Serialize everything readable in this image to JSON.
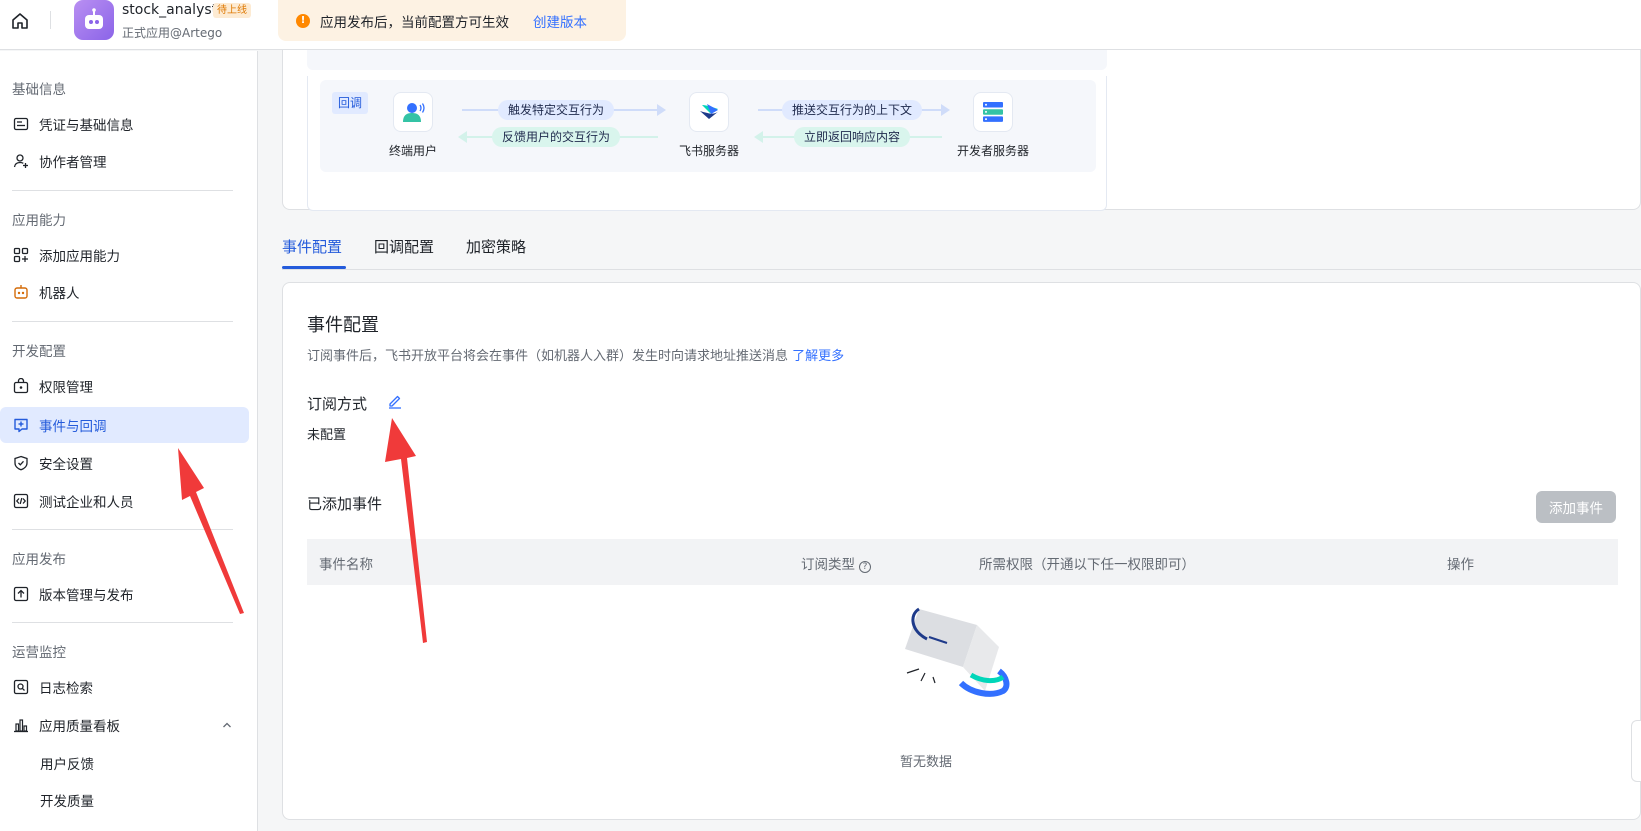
{
  "topbar": {
    "app_name": "stock_analyst",
    "app_badge": "待上线",
    "app_sub": "正式应用@Artego",
    "notice_text": "应用发布后，当前配置方可生效",
    "notice_link": "创建版本"
  },
  "sidebar": {
    "sections": [
      {
        "title": "基础信息"
      },
      {
        "title": "应用能力"
      },
      {
        "title": "开发配置"
      },
      {
        "title": "应用发布"
      },
      {
        "title": "运营监控"
      }
    ],
    "items": [
      {
        "label": "凭证与基础信息",
        "icon": "id-card-icon"
      },
      {
        "label": "协作者管理",
        "icon": "user-add-icon"
      },
      {
        "label": "添加应用能力",
        "icon": "apps-add-icon"
      },
      {
        "label": "机器人",
        "icon": "robot-icon"
      },
      {
        "label": "权限管理",
        "icon": "lock-icon"
      },
      {
        "label": "事件与回调",
        "icon": "event-icon"
      },
      {
        "label": "安全设置",
        "icon": "shield-icon"
      },
      {
        "label": "测试企业和人员",
        "icon": "code-icon"
      },
      {
        "label": "版本管理与发布",
        "icon": "upload-icon"
      },
      {
        "label": "日志检索",
        "icon": "log-search-icon"
      },
      {
        "label": "应用质量看板",
        "icon": "bar-chart-icon"
      },
      {
        "label": "用户反馈",
        "icon": ""
      },
      {
        "label": "开发质量",
        "icon": ""
      }
    ],
    "active_item": "事件与回调"
  },
  "diagram": {
    "tag": "回调",
    "nodes": [
      "终端用户",
      "飞书服务器",
      "开发者服务器"
    ],
    "arrows": [
      "触发特定交互行为",
      "反馈用户的交互行为",
      "推送交互行为的上下文",
      "立即返回响应内容"
    ]
  },
  "tabs": [
    "事件配置",
    "回调配置",
    "加密策略"
  ],
  "active_tab": "事件配置",
  "event_config": {
    "title": "事件配置",
    "desc": "订阅事件后，飞书开放平台将会在事件（如机器人入群）发生时向请求地址推送消息",
    "desc_link": "了解更多",
    "sub_label": "订阅方式",
    "sub_status": "未配置",
    "added_title": "已添加事件",
    "add_button": "添加事件",
    "columns": [
      "事件名称",
      "订阅类型",
      "所需权限（开通以下任一权限即可）",
      "操作"
    ],
    "rows": [],
    "empty_text": "暂无数据"
  },
  "colors": {
    "accent": "#245bdb",
    "link": "#3370ff",
    "warning": "#ff8800",
    "active_bg": "#e1eaff",
    "annotation_arrow": "#f03a3a"
  }
}
